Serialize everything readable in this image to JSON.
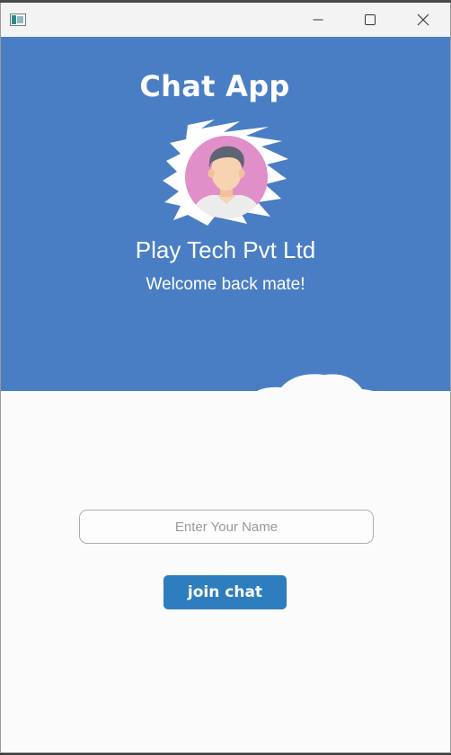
{
  "window": {
    "icon": "app-window-icon",
    "controls": [
      "minimize-icon",
      "maximize-icon",
      "close-icon"
    ]
  },
  "header": {
    "title": "Chat App",
    "avatar": "user-avatar",
    "company": "Play Tech Pvt Ltd",
    "welcome": "Welcome back mate!"
  },
  "form": {
    "name_placeholder": "Enter Your Name",
    "name_value": "",
    "join_label": "join chat"
  },
  "colors": {
    "header_bg": "#4a7ec4",
    "button_bg": "#2e7dbe",
    "avatar_circle": "#e08fc8",
    "page_bg": "#fbfbfb"
  }
}
